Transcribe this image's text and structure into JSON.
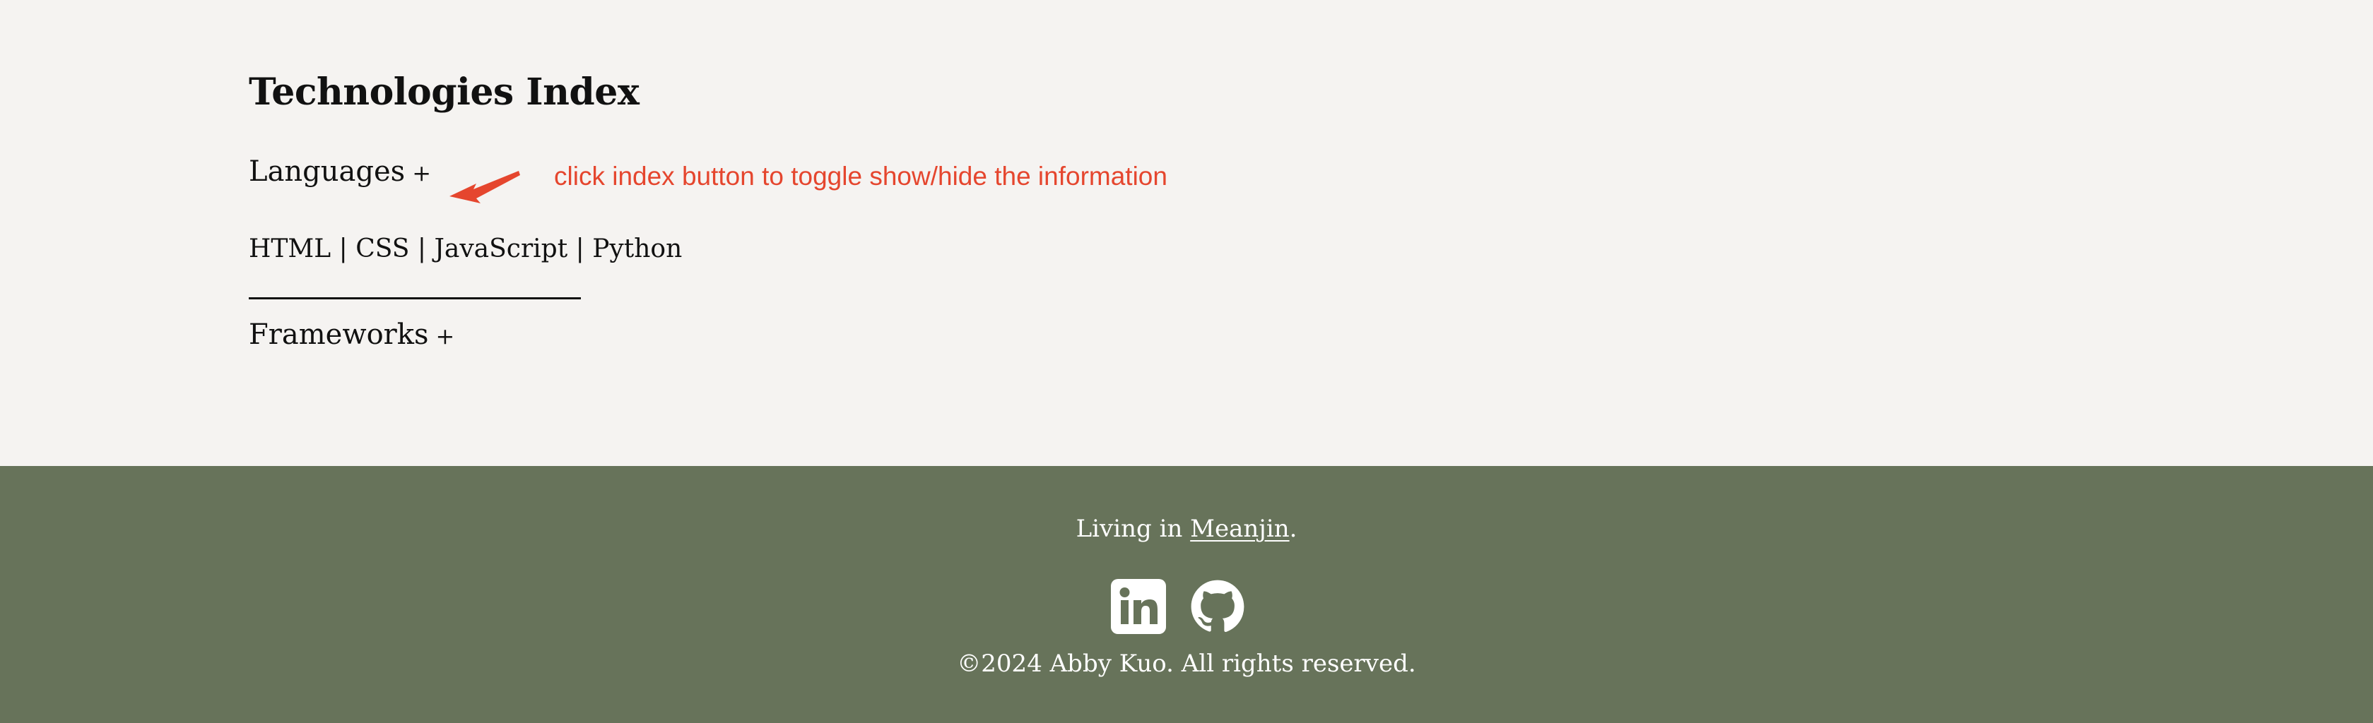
{
  "technologies": {
    "title": "Technologies Index",
    "languages": {
      "label": "Languages",
      "toggle": "+",
      "items": "HTML | CSS | JavaScript | Python"
    },
    "frameworks": {
      "label": "Frameworks",
      "toggle": "+"
    }
  },
  "annotation": {
    "text": "click index button to toggle show/hide the information",
    "color": "#e5462e"
  },
  "footer": {
    "living_prefix": "Living in ",
    "location": "Meanjin",
    "living_suffix": ".",
    "copyright": "©2024 Abby Kuo. All rights reserved.",
    "background_color": "#67735a",
    "socials": [
      {
        "name": "linkedin-icon"
      },
      {
        "name": "github-icon"
      }
    ]
  },
  "colors": {
    "page_background": "#f5f3f1",
    "text": "#111111",
    "footer_text": "#ffffff"
  }
}
